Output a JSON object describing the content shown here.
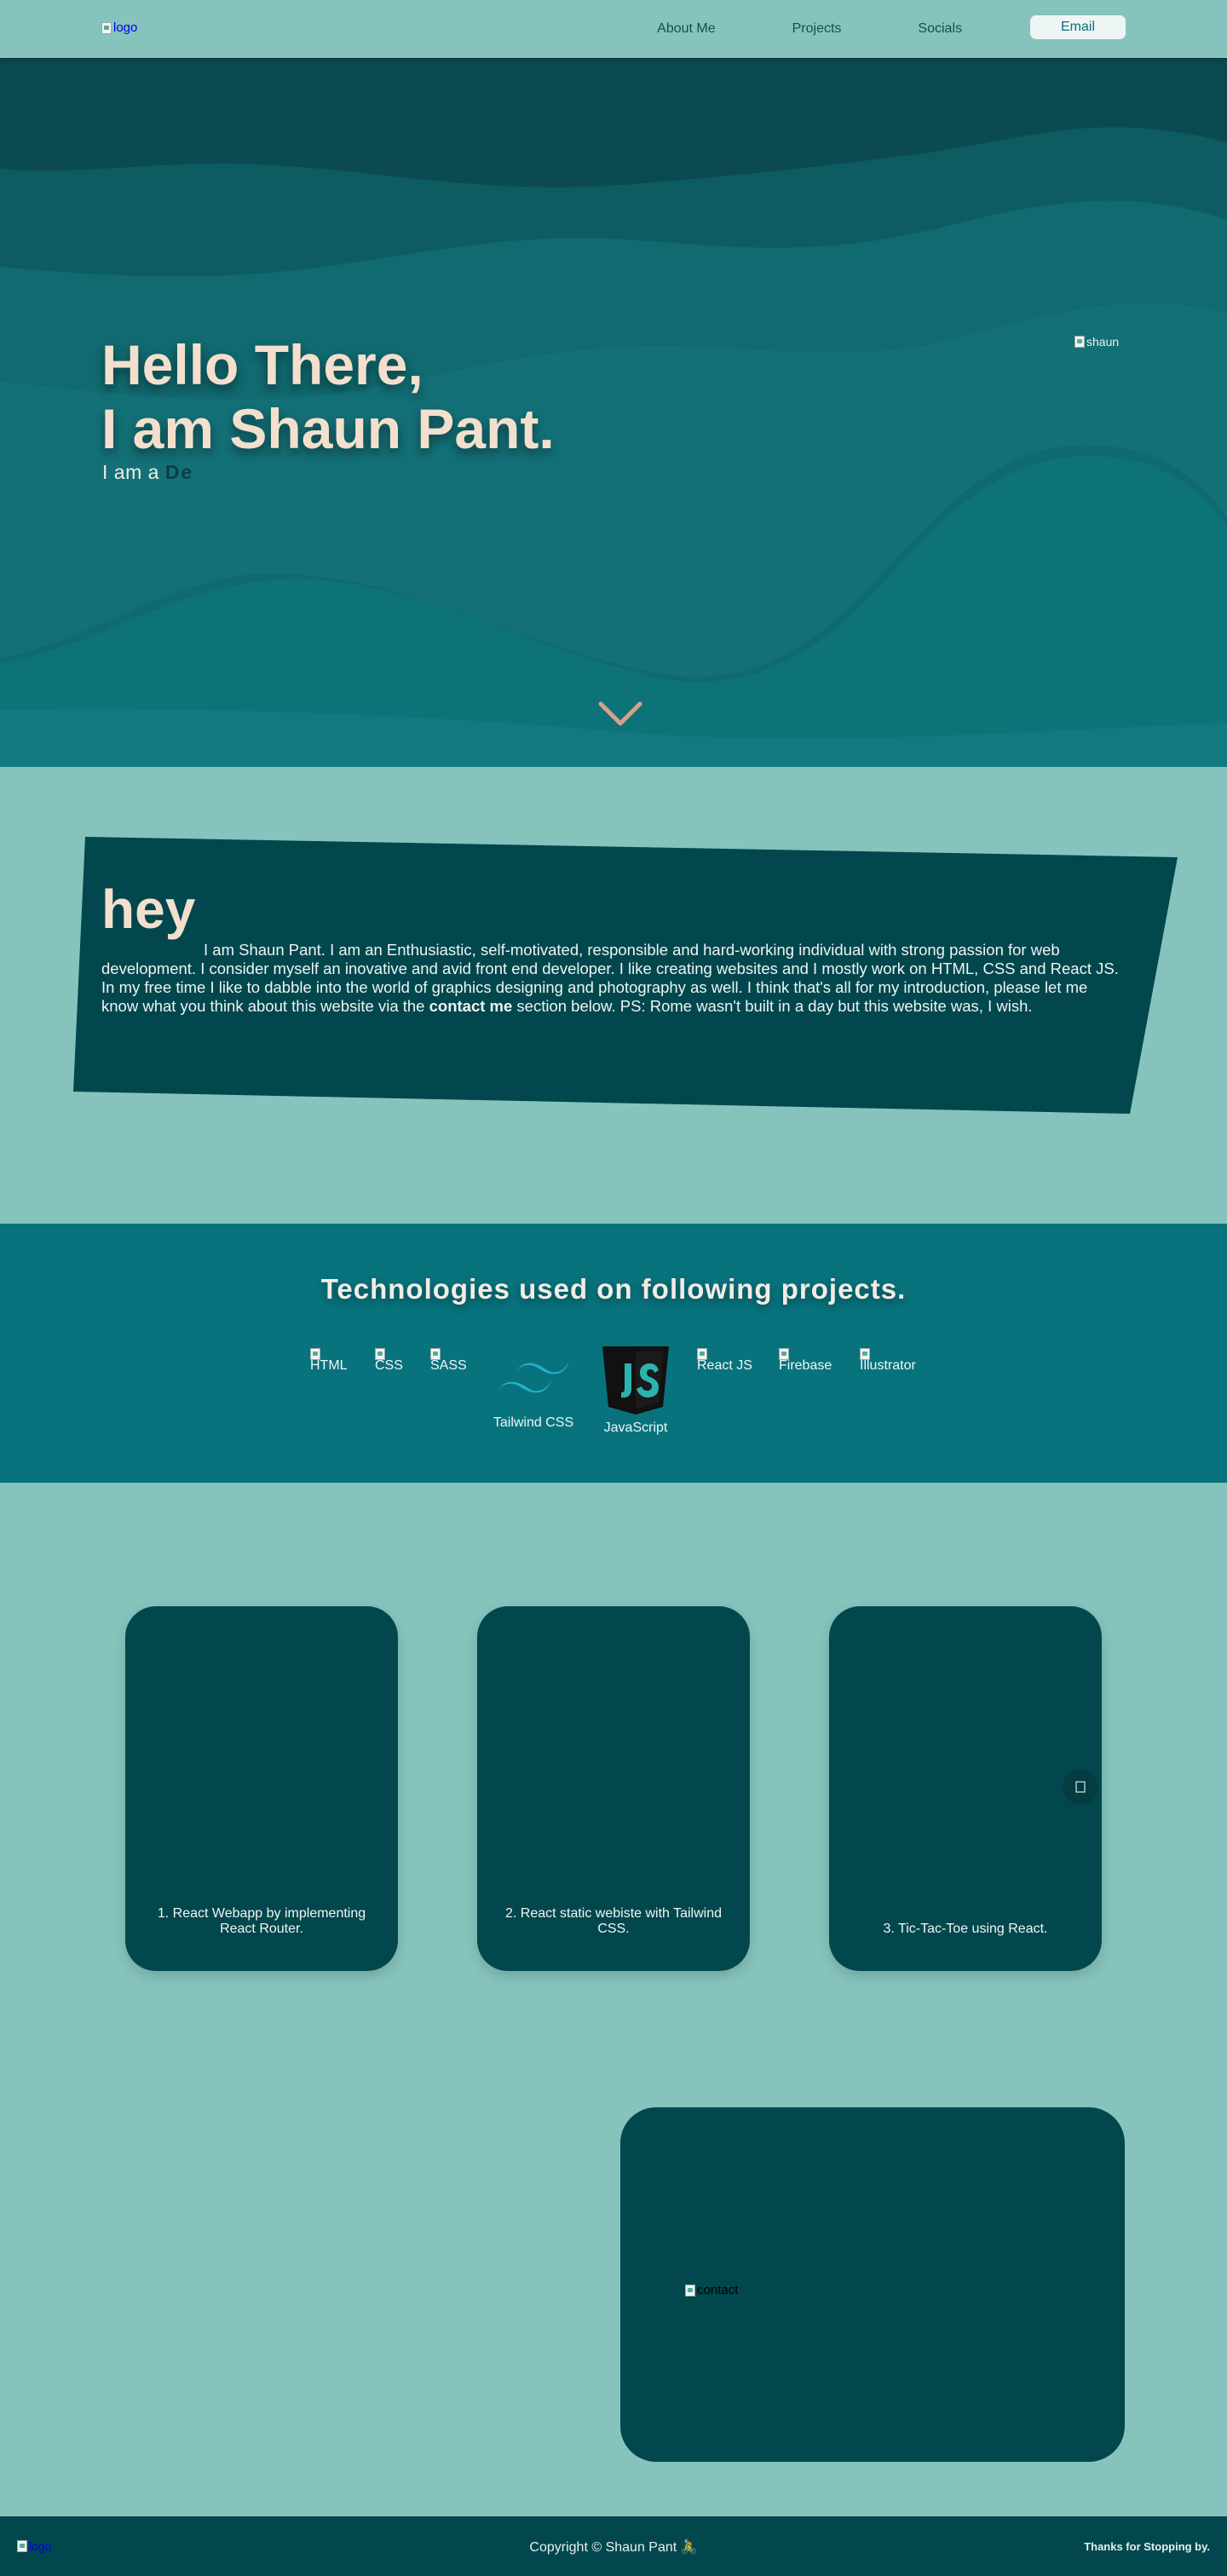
{
  "nav": {
    "logo_alt": "logo",
    "links": [
      "About Me",
      "Projects",
      "Socials"
    ],
    "email_label": "Email"
  },
  "hero": {
    "title_line1": "Hello There,",
    "title_line2": "I am Shaun Pant.",
    "subtitle_prefix": "I am a",
    "typed_text": "De",
    "photo_alt": "shaun",
    "scroll_icon": "chevron-down-icon"
  },
  "about": {
    "heading": "hey",
    "text_before": "I am Shaun Pant. I am an Enthusiastic, self-motivated, responsible and hard-working individual with strong passion for web development. I consider myself an inovative and avid front end developer. I like creating websites and I mostly work on HTML, CSS and React JS. In my free time I like to dabble into the world of graphics designing and photography as well. I think that's all for my introduction, please let me know what you think about this website via the",
    "text_bold": "contact me",
    "text_after": "section below. PS: Rome wasn't built in a day but this website was, I wish."
  },
  "tech": {
    "heading": "Technologies used on following projects.",
    "items": [
      "HTML",
      "CSS",
      "SASS",
      "Tailwind CSS",
      "JavaScript",
      "React JS",
      "Firebase",
      "Illustrator"
    ]
  },
  "projects": {
    "cards": [
      "1. React Webapp by implementing React Router.",
      "2. React static webiste with Tailwind CSS.",
      "3. Tic-Tac-Toe using React."
    ],
    "next_icon": "arrow-right-icon"
  },
  "contact": {
    "image_alt": "contact"
  },
  "footer": {
    "logo_alt": "logo",
    "copyright": "Copyright © Shaun Pant 🚴",
    "thanks": "Thanks for Stopping by."
  },
  "colors": {
    "background": "#86c3bd",
    "hero_dark": "#0d4c52",
    "hero_teal": "#16777e",
    "card": "#02474e",
    "tech_band": "#08737d",
    "accent_text": "#f3dfcd",
    "chevron": "#d9a287"
  }
}
